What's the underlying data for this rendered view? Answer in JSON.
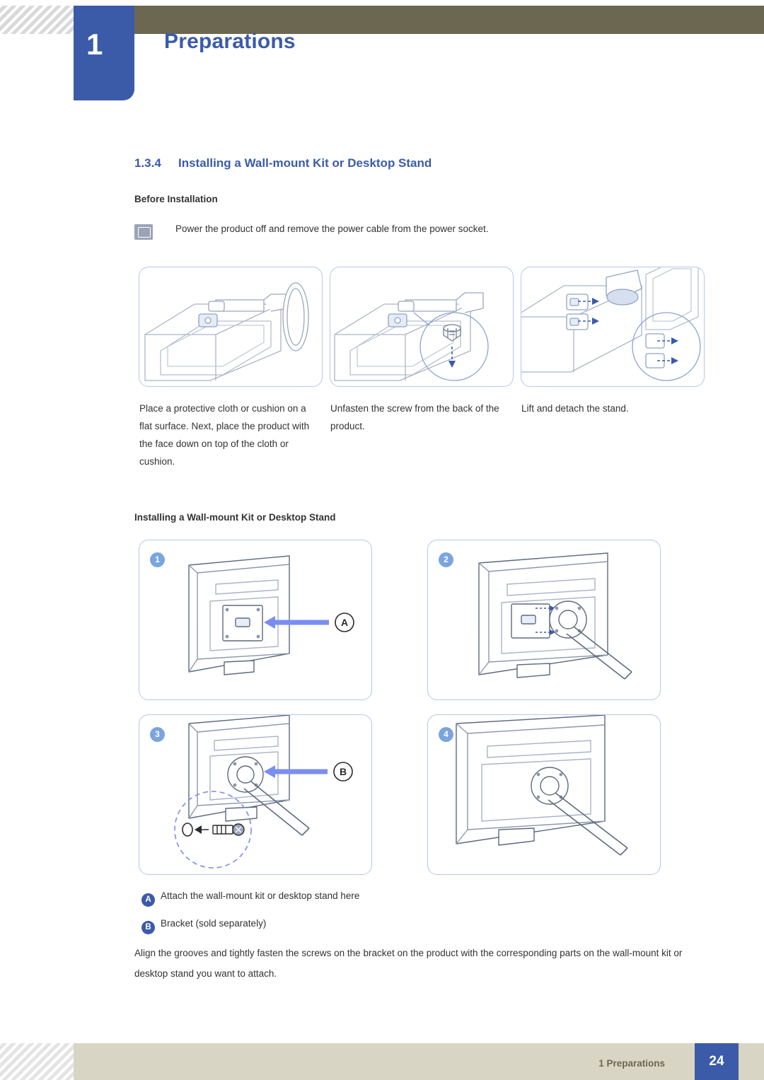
{
  "header": {
    "chapter_number": "1",
    "chapter_title": "Preparations"
  },
  "section": {
    "number": "1.3.4",
    "title": "Installing a Wall-mount Kit or Desktop Stand"
  },
  "before_installation": {
    "heading": "Before Installation",
    "note": "Power the product off and remove the power cable from the power socket.",
    "note_icon": "note-icon"
  },
  "figures_top": [
    {
      "name": "figure-place-protective-cloth",
      "caption": "Place a protective cloth or cushion on a flat surface. Next, place the product with the face down on top of the cloth or cushion."
    },
    {
      "name": "figure-unfasten-screw",
      "caption": "Unfasten the screw from the back of the product."
    },
    {
      "name": "figure-lift-detach-stand",
      "caption": "Lift and detach the stand."
    }
  ],
  "install_section": {
    "heading": "Installing a Wall-mount Kit or Desktop Stand",
    "steps": [
      {
        "number": "1",
        "marker": "A"
      },
      {
        "number": "2",
        "marker": ""
      },
      {
        "number": "3",
        "marker": "B"
      },
      {
        "number": "4",
        "marker": ""
      }
    ]
  },
  "legend": [
    {
      "badge": "A",
      "text": "Attach the wall-mount kit or desktop stand here"
    },
    {
      "badge": "B",
      "text": "Bracket (sold separately)"
    }
  ],
  "body_paragraph": "Align the grooves and tightly fasten the screws on the bracket on the product with the corresponding parts on the wall-mount kit or desktop stand you want to attach.",
  "footer": {
    "text": "1 Preparations",
    "page": "24"
  },
  "colors": {
    "accent_blue": "#3b5ba9",
    "header_bar": "#6b6751",
    "footer_bar": "#d8d5c4",
    "figure_border": "#b8c7e8"
  }
}
